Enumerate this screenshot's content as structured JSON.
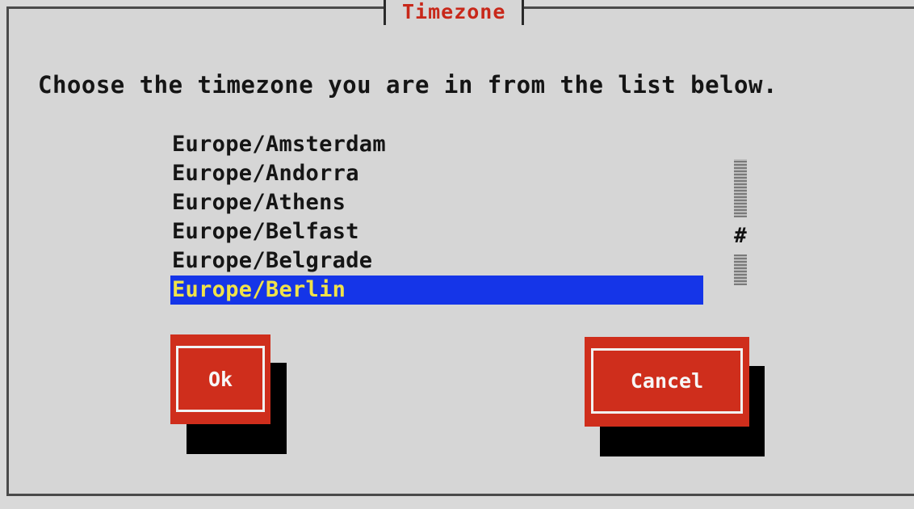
{
  "dialog": {
    "title": "Timezone",
    "prompt": "Choose the timezone you are in from the list below."
  },
  "timezones": {
    "items": [
      {
        "label": "Europe/Amsterdam"
      },
      {
        "label": "Europe/Andorra"
      },
      {
        "label": "Europe/Athens"
      },
      {
        "label": "Europe/Belfast"
      },
      {
        "label": "Europe/Belgrade"
      },
      {
        "label": "Europe/Berlin"
      }
    ],
    "selected_label": "Europe/Berlin"
  },
  "scrollbar": {
    "thumb_glyph": "#"
  },
  "buttons": {
    "ok_label": "Ok",
    "cancel_label": "Cancel"
  },
  "colors": {
    "background": "#d6d6d6",
    "title": "#c8281a",
    "selection_bg": "#1535e8",
    "selection_text": "#f0e24a",
    "button": "#cf2e1c",
    "shadow": "#000000"
  }
}
